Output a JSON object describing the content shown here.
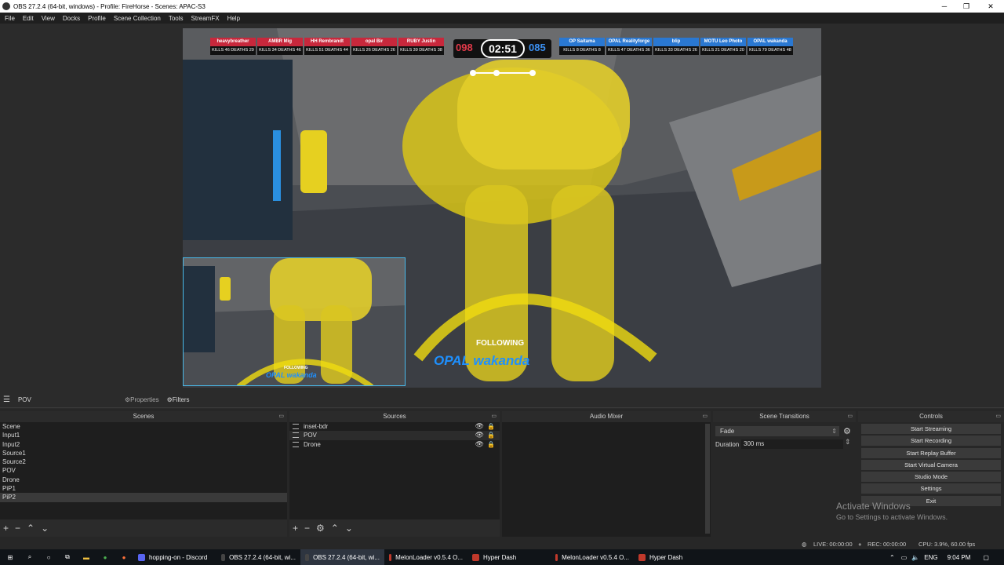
{
  "window": {
    "title": "OBS 27.2.4 (64-bit, windows) - Profile: FireHorse - Scenes: APAC-S3",
    "minimize_glyph": "─",
    "maximize_glyph": "❐",
    "close_glyph": "✕"
  },
  "menu": [
    "File",
    "Edit",
    "View",
    "Docks",
    "Profile",
    "Scene Collection",
    "Tools",
    "StreamFX",
    "Help"
  ],
  "preview": {
    "red_team": [
      {
        "name": "heavybreather",
        "stats": "KILLS 46  DEATHS 29"
      },
      {
        "name": "AMBR Mig",
        "stats": "KILLS 34  DEATHS 46"
      },
      {
        "name": "HH Rembrandt",
        "stats": "KILLS 51  DEATHS 44"
      },
      {
        "name": "opal Bir",
        "stats": "KILLS 26  DEATHS 26"
      },
      {
        "name": "RUBY Justin",
        "stats": "KILLS 39  DEATHS 38"
      }
    ],
    "blue_team": [
      {
        "name": "OP Saitama",
        "stats": "KILLS 8  DEATHS 8"
      },
      {
        "name": "OPAL Realityforge",
        "stats": "KILLS 47  DEATHS 36"
      },
      {
        "name": "blip",
        "stats": "KILLS 33  DEATHS 26"
      },
      {
        "name": "MOTU Leo Photo",
        "stats": "KILLS 21  DEATHS 20"
      },
      {
        "name": "OPAL wakanda",
        "stats": "KILLS 79  DEATHS 48"
      }
    ],
    "score_red": "098",
    "timer": "02:51",
    "score_blue": "085",
    "following_label": "FOLLOWING",
    "followed_player": "OPAL wakanda",
    "pip_following_label": "FOLLOWING",
    "pip_followed_player": "OPAL wakanda"
  },
  "source_toolbar": {
    "selected_source": "POV",
    "properties_label": "Properties",
    "filters_label": "Filters"
  },
  "scenes": {
    "title": "Scenes",
    "items": [
      "Scene",
      "Input1",
      "Input2",
      "Source1",
      "Source2",
      "POV",
      "Drone",
      "PiP1",
      "PiP2"
    ],
    "selected": "PiP2"
  },
  "sources": {
    "title": "Sources",
    "items": [
      "inset-bdr",
      "POV",
      "Drone"
    ]
  },
  "audio_mixer": {
    "title": "Audio Mixer"
  },
  "transitions": {
    "title": "Scene Transitions",
    "selected": "Fade",
    "duration_label": "Duration",
    "duration_value": "300 ms"
  },
  "controls": {
    "title": "Controls",
    "buttons": [
      "Start Streaming",
      "Start Recording",
      "Start Replay Buffer",
      "Start Virtual Camera",
      "Studio Mode",
      "Settings",
      "Exit"
    ]
  },
  "status": {
    "live": "LIVE: 00:00:00",
    "rec": "REC: 00:00:00",
    "cpu": "CPU: 3.9%, 60.00 fps"
  },
  "watermark": {
    "title": "Activate Windows",
    "subtitle": "Go to Settings to activate Windows."
  },
  "taskbar": {
    "items": [
      {
        "label": "hopping-on - Discord",
        "color": "#5865f2",
        "active": false
      },
      {
        "label": "OBS 27.2.4 (64-bit, wi...",
        "color": "#444444",
        "active": false
      },
      {
        "label": "OBS 27.2.4 (64-bit, wi...",
        "color": "#444444",
        "active": true
      },
      {
        "label": "MelonLoader v0.5.4 O...",
        "color": "#c0392b",
        "active": false
      },
      {
        "label": "Hyper Dash",
        "color": "#c0392b",
        "active": false
      },
      {
        "label": "MelonLoader v0.5.4 O...",
        "color": "#c0392b",
        "active": false
      },
      {
        "label": "Hyper Dash",
        "color": "#c0392b",
        "active": false
      }
    ],
    "language": "ENG",
    "time": "9:04 PM"
  }
}
